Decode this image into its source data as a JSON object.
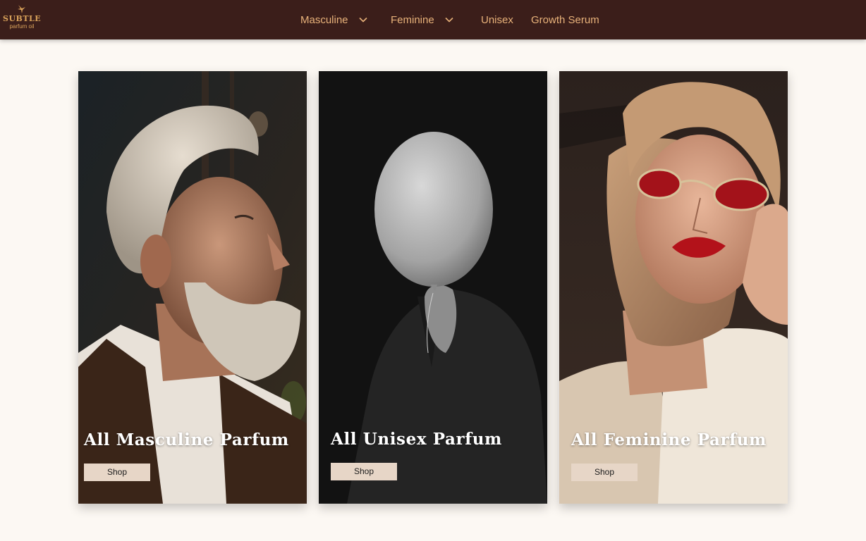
{
  "brand": {
    "name": "SUBTLE",
    "tagline": "parfum oil",
    "mark_icon": "bird-icon",
    "accent_color": "#d9a25a"
  },
  "nav": {
    "items": [
      {
        "label": "Masculine",
        "has_dropdown": true
      },
      {
        "label": "Feminine",
        "has_dropdown": true
      },
      {
        "label": "Unisex",
        "has_dropdown": false
      },
      {
        "label": "Growth Serum",
        "has_dropdown": false
      }
    ],
    "text_color": "#e8b27a",
    "bar_color": "#3b1e1a"
  },
  "cards": [
    {
      "title": "All Masculine Parfum",
      "button_label": "Shop",
      "image": "older bearded man in profile"
    },
    {
      "title": "All Unisex Parfum",
      "button_label": "Shop",
      "image": "person holding white balloon over face"
    },
    {
      "title": "All Feminine Parfum",
      "button_label": "Shop",
      "image": "woman in red sunglasses and headscarf"
    }
  ],
  "colors": {
    "page_background": "#fcf8f3",
    "button_background": "#e7d6c7"
  }
}
